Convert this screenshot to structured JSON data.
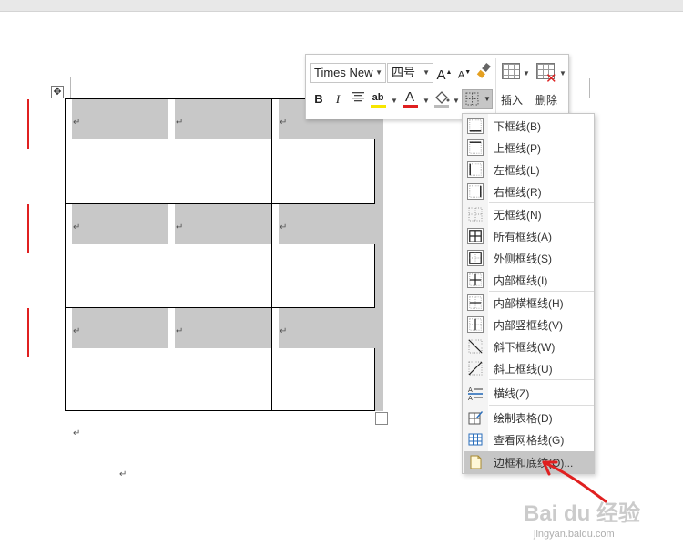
{
  "toolbar": {
    "font_name": "Times New",
    "font_size": "四号",
    "grow_font": "A",
    "shrink_font": "A",
    "bold": "B",
    "italic": "I",
    "highlight_glyph": "ab",
    "font_color_glyph": "A",
    "insert_label": "插入",
    "delete_label": "删除",
    "highlight_color": "#f7e600",
    "font_color": "#e02020"
  },
  "table": {
    "paragraph_mark": "↵",
    "rows": 3,
    "cols": 3,
    "shade_color": "#c8c8c8"
  },
  "body": {
    "paragraph_mark": "↵"
  },
  "border_menu": {
    "items": [
      {
        "label": "下框线(B)",
        "icon": "bottom-border-icon"
      },
      {
        "label": "上框线(P)",
        "icon": "top-border-icon"
      },
      {
        "label": "左框线(L)",
        "icon": "left-border-icon"
      },
      {
        "label": "右框线(R)",
        "icon": "right-border-icon"
      },
      {
        "label": "无框线(N)",
        "icon": "no-border-icon"
      },
      {
        "label": "所有框线(A)",
        "icon": "all-borders-icon"
      },
      {
        "label": "外侧框线(S)",
        "icon": "outside-borders-icon"
      },
      {
        "label": "内部框线(I)",
        "icon": "inside-borders-icon"
      },
      {
        "label": "内部横框线(H)",
        "icon": "inside-horizontal-border-icon"
      },
      {
        "label": "内部竖框线(V)",
        "icon": "inside-vertical-border-icon"
      },
      {
        "label": "斜下框线(W)",
        "icon": "diagonal-down-border-icon"
      },
      {
        "label": "斜上框线(U)",
        "icon": "diagonal-up-border-icon"
      },
      {
        "label": "横线(Z)",
        "icon": "horizontal-line-icon"
      },
      {
        "label": "绘制表格(D)",
        "icon": "draw-table-icon"
      },
      {
        "label": "查看网格线(G)",
        "icon": "view-gridlines-icon"
      },
      {
        "label": "边框和底纹(O)...",
        "icon": "borders-shading-icon"
      }
    ]
  },
  "watermark": {
    "logo": "Bai du 经验",
    "url": "jingyan.baidu.com"
  }
}
